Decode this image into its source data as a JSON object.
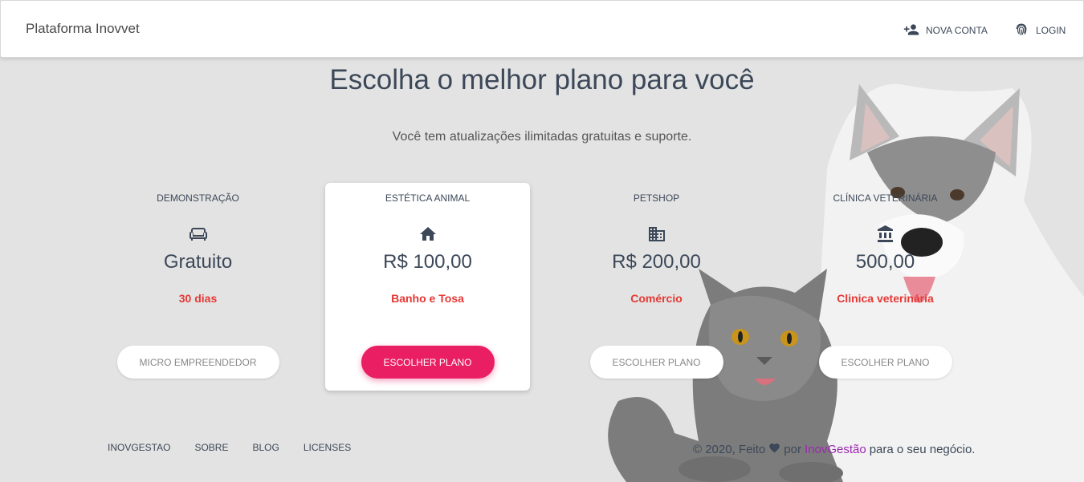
{
  "navbar": {
    "brand": "Plataforma Inovvet",
    "nova_conta": "NOVA CONTA",
    "login": "LOGIN"
  },
  "header": {
    "title": "Escolha o melhor plano para você",
    "subtitle": "Você tem atualizações ilimitadas gratuitas e suporte."
  },
  "plans": [
    {
      "category": "DEMONSTRAÇÃO",
      "icon": "couch-icon",
      "price": "Gratuito",
      "desc": "30 dias",
      "button": "MICRO EMPREENDEDOR"
    },
    {
      "category": "ESTÉTICA ANIMAL",
      "icon": "home-icon",
      "price": "R$ 100,00",
      "desc": "Banho e Tosa",
      "button": "ESCOLHER PLANO"
    },
    {
      "category": "PETSHOP",
      "icon": "business-icon",
      "price": "R$ 200,00",
      "desc": "Comércio",
      "button": "ESCOLHER PLANO"
    },
    {
      "category": "CLÍNICA VETERINÁRIA",
      "icon": "bank-icon",
      "price": "500,00",
      "desc": "Clinica veterinária",
      "button": "ESCOLHER PLANO"
    }
  ],
  "footer": {
    "links": [
      "INOVGESTAO",
      "SOBRE",
      "BLOG",
      "LICENSES"
    ],
    "copyright_prefix": "© 2020, Feito",
    "copyright_by": "por",
    "brand": "InovGestão",
    "copyright_suffix": "para o seu negócio."
  },
  "colors": {
    "accent_pink": "#e91e63",
    "desc_red": "#e53935",
    "link_purple": "#9c27b0",
    "background": "#e3e3e3"
  }
}
